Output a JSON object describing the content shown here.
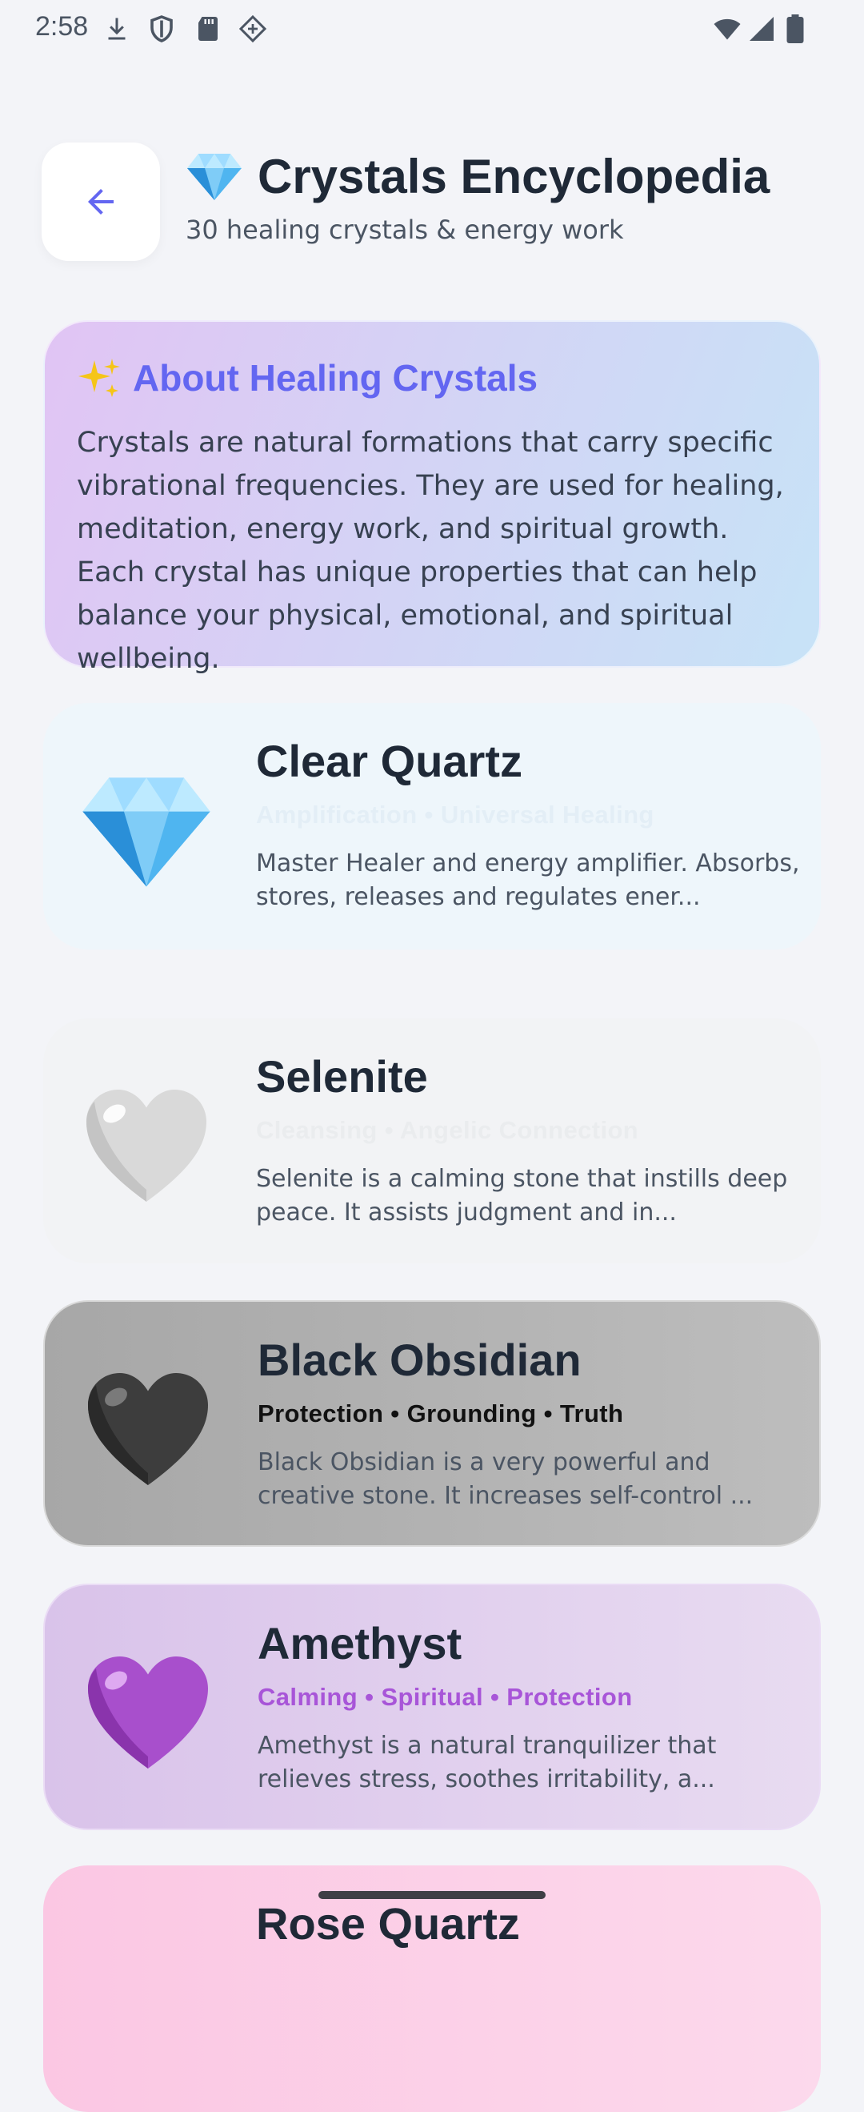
{
  "status_bar": {
    "time": "2:58",
    "left_icons": [
      "download-icon",
      "shield-icon",
      "sd-card-icon",
      "diamond-badge-icon"
    ],
    "right_icons": [
      "wifi-icon",
      "signal-icon",
      "battery-icon"
    ]
  },
  "header": {
    "title": "Crystals Encyclopedia",
    "subtitle": "30 healing crystals & energy work",
    "title_icon": "gem-icon",
    "back_icon": "arrow-left-icon"
  },
  "about": {
    "icon": "sparkles-icon",
    "title": "About Healing Crystals",
    "text": "Crystals are natural formations that carry specific vibrational frequencies. They are used for healing, meditation, energy work, and spiritual growth. Each crystal has unique properties that can help balance your physical, emotional, and spiritual wellbeing."
  },
  "crystals": [
    {
      "name": "Clear Quartz",
      "tags": "Amplification • Universal Healing",
      "description": "Master Healer and energy amplifier. Absorbs, stores, releases and regulates ener...",
      "icon": "gem-icon",
      "tag_color": "#eef6fb"
    },
    {
      "name": "Selenite",
      "tags": "Cleansing • Angelic Connection",
      "description": "Selenite is a calming stone that instills deep peace. It assists judgment and in...",
      "icon": "white-heart-icon",
      "tag_color": "#f1f3f5"
    },
    {
      "name": "Black Obsidian",
      "tags": "Protection • Grounding • Truth",
      "description": "Black Obsidian is a very powerful and creative stone. It increases self-control ...",
      "icon": "black-heart-icon",
      "tag_color": "#111111"
    },
    {
      "name": "Amethyst",
      "tags": "Calming • Spiritual • Protection",
      "description": "Amethyst is a natural tranquilizer that relieves stress, soothes irritability, a...",
      "icon": "purple-heart-icon",
      "tag_color": "#a855d8"
    },
    {
      "name": "Rose Quartz",
      "icon": "pink-heart-icon"
    }
  ]
}
